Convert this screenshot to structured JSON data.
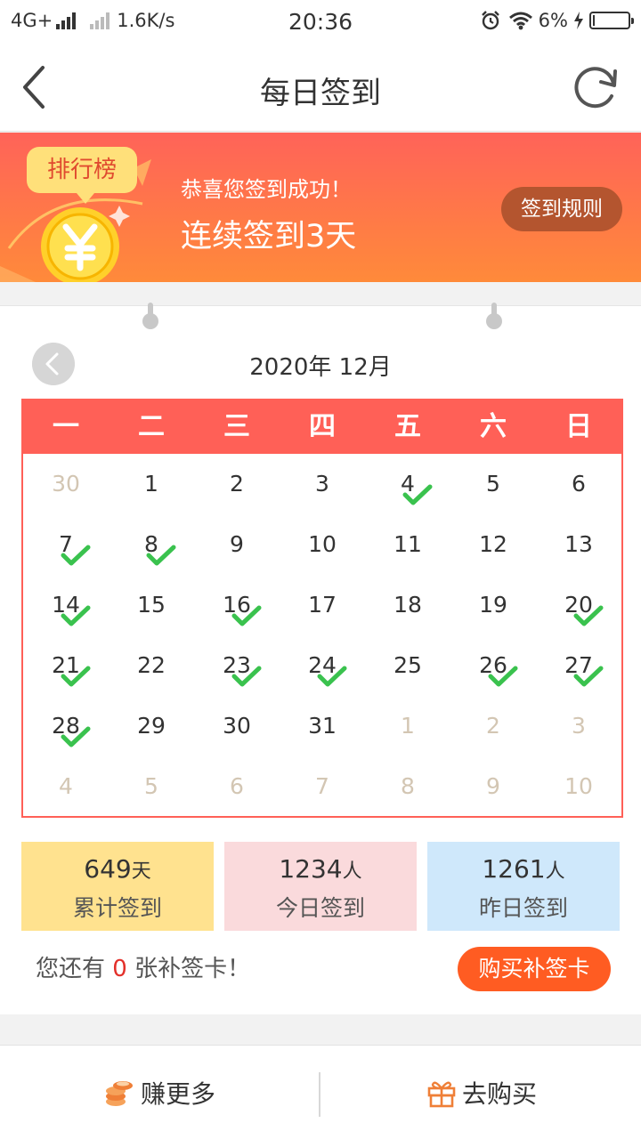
{
  "status_bar": {
    "network": "4G+",
    "speed": "1.6K/s",
    "time": "20:36",
    "battery": "6%",
    "battery_level": 0.06
  },
  "nav": {
    "title": "每日签到"
  },
  "banner": {
    "rank_label": "排行榜",
    "congrats": "恭喜您签到成功！",
    "streak": "连续签到3天",
    "rule_button": "签到规则"
  },
  "calendar": {
    "month_title": "2020年 12月",
    "weekdays": [
      "一",
      "二",
      "三",
      "四",
      "五",
      "六",
      "日"
    ],
    "weeks": [
      [
        {
          "d": "30",
          "o": 1
        },
        {
          "d": "1"
        },
        {
          "d": "2"
        },
        {
          "d": "3"
        },
        {
          "d": "4",
          "c": 1
        },
        {
          "d": "5"
        },
        {
          "d": "6"
        }
      ],
      [
        {
          "d": "7",
          "c": 1
        },
        {
          "d": "8",
          "c": 1
        },
        {
          "d": "9"
        },
        {
          "d": "10"
        },
        {
          "d": "11"
        },
        {
          "d": "12"
        },
        {
          "d": "13"
        }
      ],
      [
        {
          "d": "14",
          "c": 1
        },
        {
          "d": "15"
        },
        {
          "d": "16",
          "c": 1
        },
        {
          "d": "17"
        },
        {
          "d": "18"
        },
        {
          "d": "19"
        },
        {
          "d": "20",
          "c": 1
        }
      ],
      [
        {
          "d": "21",
          "c": 1
        },
        {
          "d": "22"
        },
        {
          "d": "23",
          "c": 1
        },
        {
          "d": "24",
          "c": 1
        },
        {
          "d": "25"
        },
        {
          "d": "26",
          "c": 1
        },
        {
          "d": "27",
          "c": 1
        }
      ],
      [
        {
          "d": "28",
          "c": 1
        },
        {
          "d": "29"
        },
        {
          "d": "30"
        },
        {
          "d": "31"
        },
        {
          "d": "1",
          "o": 1
        },
        {
          "d": "2",
          "o": 1
        },
        {
          "d": "3",
          "o": 1
        }
      ],
      [
        {
          "d": "4",
          "o": 1
        },
        {
          "d": "5",
          "o": 1
        },
        {
          "d": "6",
          "o": 1
        },
        {
          "d": "7",
          "o": 1
        },
        {
          "d": "8",
          "o": 1
        },
        {
          "d": "9",
          "o": 1
        },
        {
          "d": "10",
          "o": 1
        }
      ]
    ]
  },
  "stats": [
    {
      "value": "649",
      "unit": "天",
      "label": "累计签到"
    },
    {
      "value": "1234",
      "unit": "人",
      "label": "今日签到"
    },
    {
      "value": "1261",
      "unit": "人",
      "label": "昨日签到"
    }
  ],
  "makeup": {
    "prefix": "您还有 ",
    "count": "0",
    "suffix": " 张补签卡！",
    "buy_button": "购买补签卡"
  },
  "bottom_tabs": {
    "earn": "赚更多",
    "shop": "去购买"
  },
  "colors": {
    "accent": "#ff6057",
    "check": "#3ac24e",
    "buy": "#ff5c22"
  }
}
